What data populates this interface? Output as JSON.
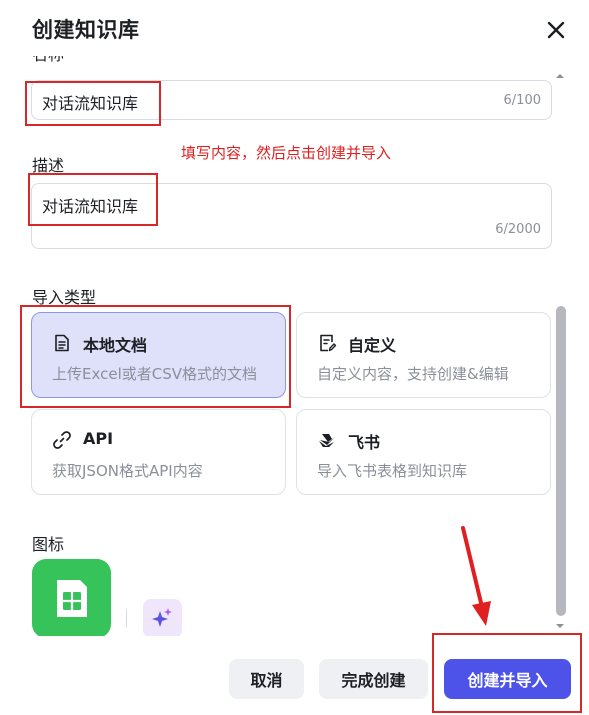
{
  "dialog": {
    "title": "创建知识库"
  },
  "name_field": {
    "label": "名称",
    "value": "对话流知识库",
    "counter": "6/100"
  },
  "annotation": {
    "hint": "填写内容，然后点击创建并导入"
  },
  "description_field": {
    "label": "描述",
    "value": "对话流知识库",
    "counter": "6/2000"
  },
  "import_type": {
    "label": "导入类型",
    "options": [
      {
        "title": "本地文档",
        "desc": "上传Excel或者CSV格式的文档",
        "icon": "document-icon",
        "selected": true
      },
      {
        "title": "自定义",
        "desc": "自定义内容，支持创建&编辑",
        "icon": "edit-document-icon",
        "selected": false
      },
      {
        "title": "API",
        "desc": "获取JSON格式API内容",
        "icon": "link-icon",
        "selected": false
      },
      {
        "title": "飞书",
        "desc": "导入飞书表格到知识库",
        "icon": "feishu-icon",
        "selected": false
      }
    ]
  },
  "icon_section": {
    "label": "图标",
    "tile_color": "#35c35a",
    "tile_icon": "spreadsheet-icon"
  },
  "footer": {
    "cancel_label": "取消",
    "done_label": "完成创建",
    "import_label": "创建并导入"
  },
  "colors": {
    "accent": "#4d53e8",
    "annotation_red": "#d62828",
    "selected_card_bg": "#dfe1fb"
  }
}
